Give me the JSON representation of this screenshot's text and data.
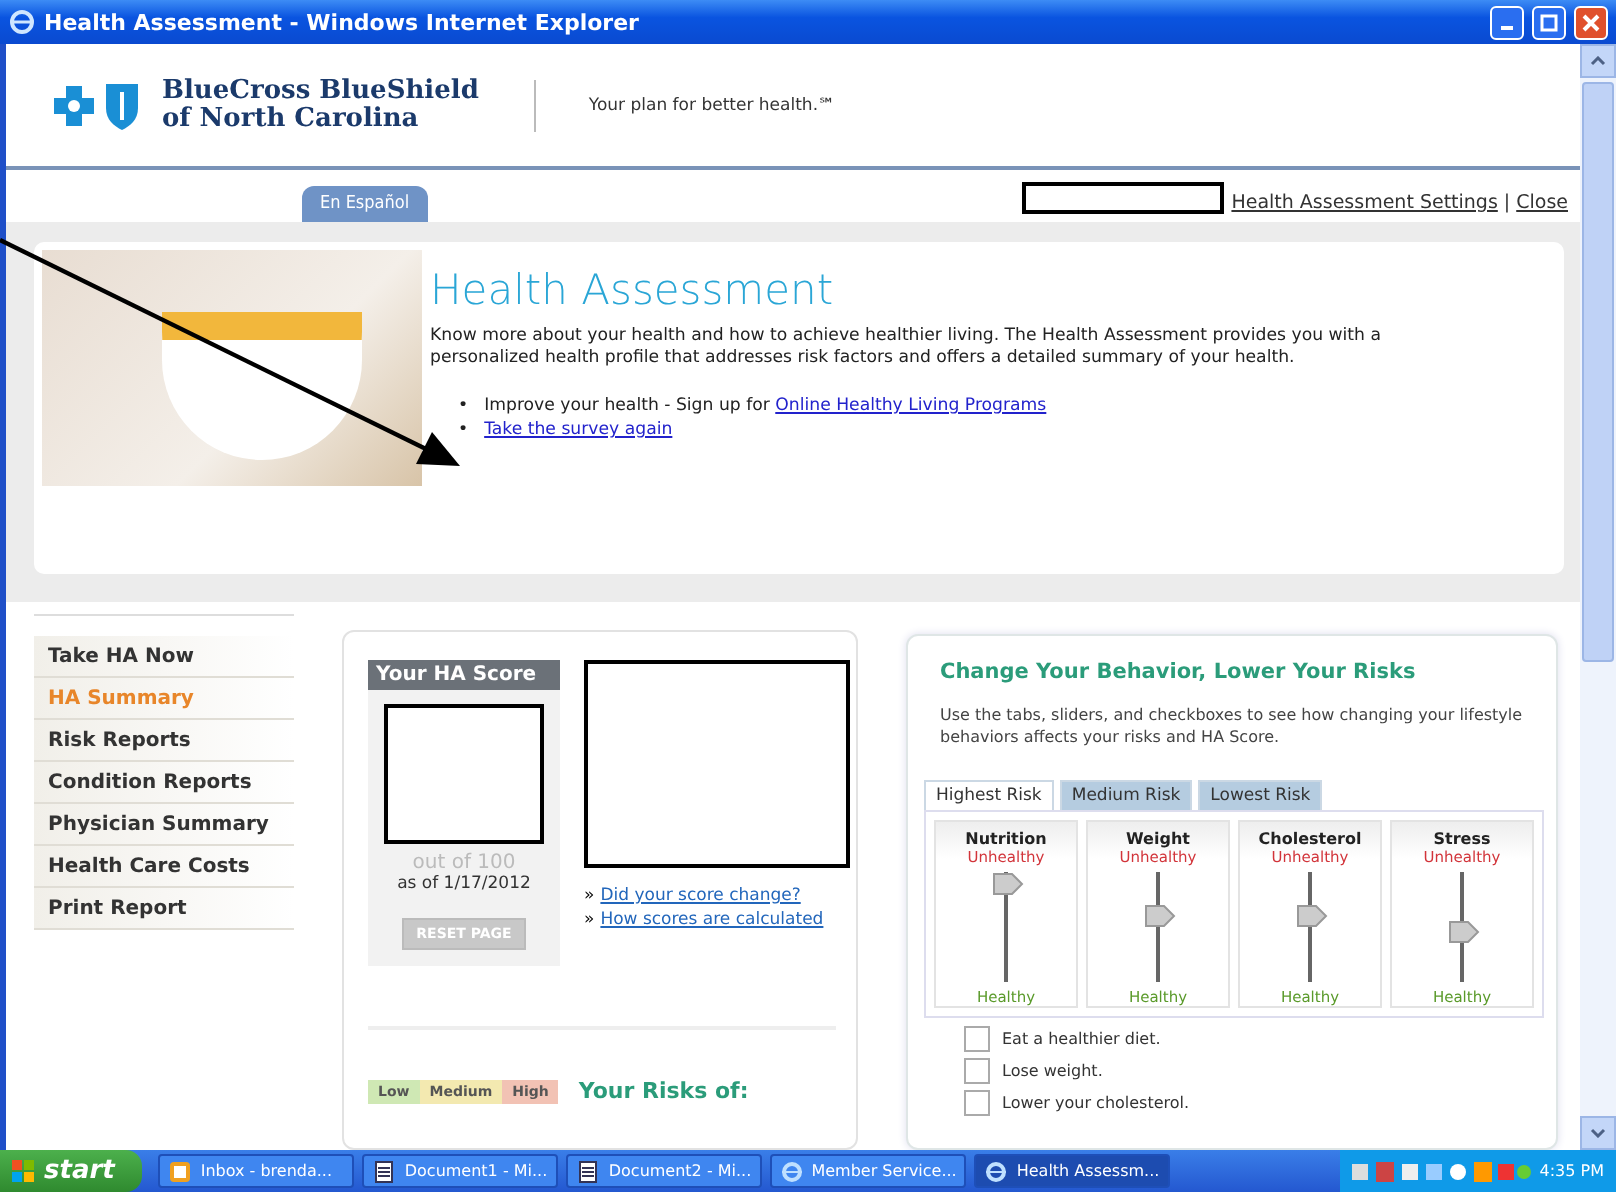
{
  "window": {
    "title": "Health Assessment - Windows Internet Explorer"
  },
  "header": {
    "brand_line1": "BlueCross BlueShield",
    "brand_line2": "of North Carolina",
    "tagline": "Your plan for better health.℠",
    "language_tab": "En Español",
    "settings_link": "Health Assessment Settings",
    "separator": "|",
    "close_link": "Close"
  },
  "hero": {
    "title": "Health Assessment",
    "description": "Know more about your health and how to achieve healthier living. The Health Assessment provides you with a personalized health profile that addresses risk factors and offers a detailed summary of your health.",
    "bullets": [
      {
        "marker": "•",
        "text": "Improve your health - Sign up for",
        "link": "Online Healthy Living Programs"
      },
      {
        "marker": "•",
        "link": "Take the survey again"
      }
    ]
  },
  "nav": [
    {
      "label": "Take HA Now",
      "selected": false
    },
    {
      "label": "HA Summary",
      "selected": true
    },
    {
      "label": "Risk Reports",
      "selected": false
    },
    {
      "label": "Condition Reports",
      "selected": false
    },
    {
      "label": "Physician Summary",
      "selected": false
    },
    {
      "label": "Health Care Costs",
      "selected": false
    },
    {
      "label": "Print Report",
      "selected": false
    }
  ],
  "score": {
    "title": "Your HA Score",
    "out_of": "out of 100",
    "as_of": "as of 1/17/2012",
    "reset_button": "RESET PAGE",
    "reset_disabled": true,
    "link_marker": "»",
    "links": [
      "Did your score change?",
      "How scores are calculated"
    ],
    "legend": [
      {
        "label": "Low",
        "color": "#cfe8b4"
      },
      {
        "label": "Medium",
        "color": "#f3e9b0"
      },
      {
        "label": "High",
        "color": "#f2c2b4"
      }
    ],
    "risks_title": "Your Risks of:"
  },
  "behavior": {
    "title": "Change Your Behavior, Lower Your Risks",
    "description": "Use the tabs, sliders, and checkboxes to see how changing your lifestyle behaviors affects your risks and HA Score.",
    "tabs": [
      {
        "label": "Highest Risk",
        "selected": true
      },
      {
        "label": "Medium Risk",
        "selected": false
      },
      {
        "label": "Lowest Risk",
        "selected": false
      }
    ],
    "sliders": [
      {
        "name": "Nutrition",
        "top_label": "Unhealthy",
        "bottom_label": "Healthy",
        "level": 0.9
      },
      {
        "name": "Weight",
        "top_label": "Unhealthy",
        "bottom_label": "Healthy",
        "level": 0.6
      },
      {
        "name": "Cholesterol",
        "top_label": "Unhealthy",
        "bottom_label": "Healthy",
        "level": 0.6
      },
      {
        "name": "Stress",
        "top_label": "Unhealthy",
        "bottom_label": "Healthy",
        "level": 0.45
      }
    ],
    "checkboxes": [
      {
        "label": "Eat a healthier diet.",
        "checked": false
      },
      {
        "label": "Lose weight.",
        "checked": false
      },
      {
        "label": "Lower your cholesterol.",
        "checked": false
      }
    ]
  },
  "taskbar": {
    "start": "start",
    "items": [
      {
        "label": "Inbox - brenda...",
        "kind": "mail",
        "selected": false
      },
      {
        "label": "Document1 - Mi...",
        "kind": "document",
        "selected": false
      },
      {
        "label": "Document2 - Mi...",
        "kind": "document",
        "selected": false
      },
      {
        "label": "Member Service...",
        "kind": "browser",
        "selected": false
      },
      {
        "label": "Health Assessm...",
        "kind": "browser",
        "selected": true
      }
    ],
    "clock": "4:35 PM"
  }
}
